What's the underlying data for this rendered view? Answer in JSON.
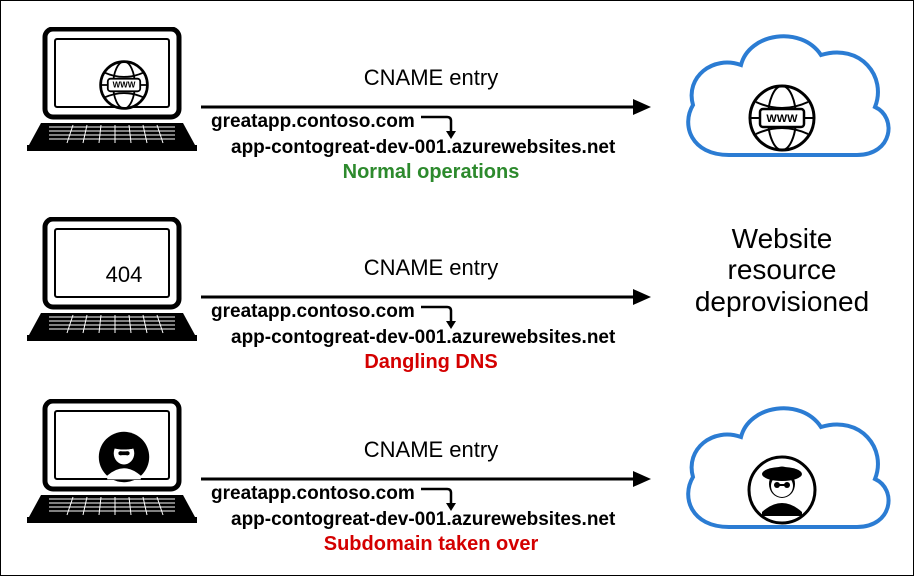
{
  "rows": [
    {
      "cname_label": "CNAME entry",
      "src_domain": "greatapp.contoso.com",
      "dst_domain": "app-contogreat-dev-001.azurewebsites.net",
      "status_text": "Normal operations",
      "status_class": "green",
      "laptop_icon": "globe-www",
      "right_kind": "cloud",
      "cloud_icon": "globe-www"
    },
    {
      "cname_label": "CNAME entry",
      "src_domain": "greatapp.contoso.com",
      "dst_domain": "app-contogreat-dev-001.azurewebsites.net",
      "status_text": "Dangling DNS",
      "status_class": "red",
      "laptop_icon": "404",
      "right_kind": "text",
      "right_text": "Website resource deprovisioned"
    },
    {
      "cname_label": "CNAME entry",
      "src_domain": "greatapp.contoso.com",
      "dst_domain": "app-contogreat-dev-001.azurewebsites.net",
      "status_text": "Subdomain taken over",
      "status_class": "red",
      "laptop_icon": "attacker",
      "right_kind": "cloud",
      "cloud_icon": "attacker"
    }
  ]
}
